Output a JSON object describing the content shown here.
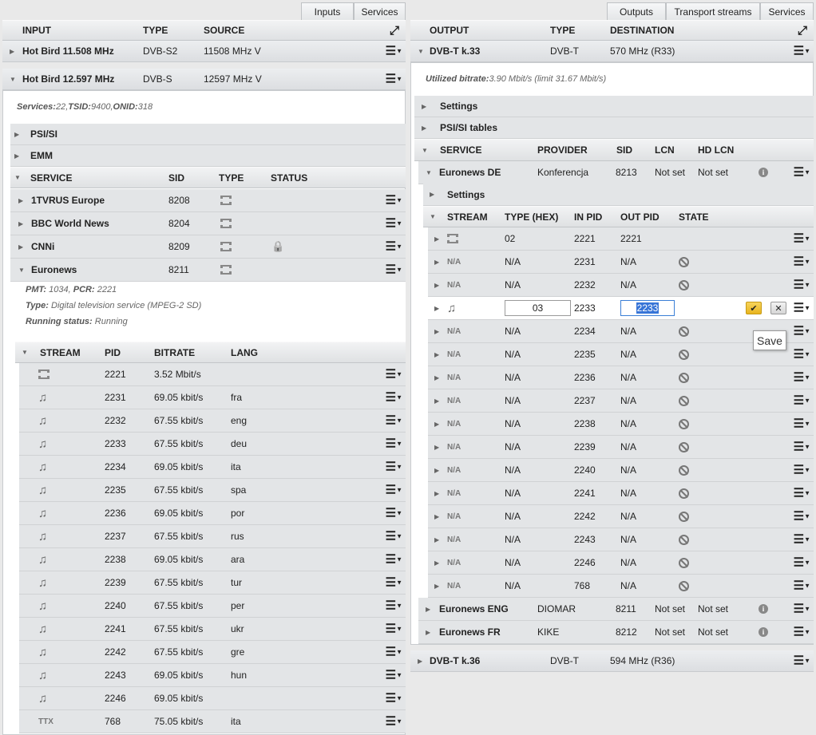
{
  "left": {
    "tabs": [
      "Inputs",
      "Services"
    ],
    "columns": {
      "input": "INPUT",
      "type": "TYPE",
      "source": "SOURCE"
    },
    "inputs": [
      {
        "name": "Hot Bird 11.508 MHz",
        "type": "DVB-S2",
        "source": "11508 MHz V"
      },
      {
        "name": "Hot Bird 12.597 MHz",
        "type": "DVB-S",
        "source": "12597 MHz V"
      }
    ],
    "summary": {
      "services_label": "Services:",
      "services": "22",
      "tsid_label": "TSID:",
      "tsid": "9400",
      "onid_label": "ONID:",
      "onid": "318"
    },
    "sections": [
      "PSI/SI",
      "EMM"
    ],
    "service_columns": {
      "service": "SERVICE",
      "sid": "SID",
      "type": "TYPE",
      "status": "STATUS"
    },
    "services": [
      {
        "name": "1TVRUS Europe",
        "sid": "8208"
      },
      {
        "name": "BBC World News",
        "sid": "8204"
      },
      {
        "name": "CNNi",
        "sid": "8209"
      },
      {
        "name": "Euronews",
        "sid": "8211"
      }
    ],
    "details": {
      "pmt_label": "PMT:",
      "pmt": "1034",
      "pcr_label": "PCR:",
      "pcr": "2221",
      "type_label": "Type:",
      "type": "Digital television service (MPEG-2 SD)",
      "status_label": "Running status:",
      "status": "Running"
    },
    "stream_columns": {
      "stream": "STREAM",
      "pid": "PID",
      "bitrate": "BITRATE",
      "lang": "LANG"
    },
    "streams": [
      {
        "icon": "film",
        "pid": "2221",
        "bitrate": "3.52 Mbit/s",
        "lang": ""
      },
      {
        "icon": "audio",
        "pid": "2231",
        "bitrate": "69.05 kbit/s",
        "lang": "fra"
      },
      {
        "icon": "audio",
        "pid": "2232",
        "bitrate": "67.55 kbit/s",
        "lang": "eng"
      },
      {
        "icon": "audio",
        "pid": "2233",
        "bitrate": "67.55 kbit/s",
        "lang": "deu"
      },
      {
        "icon": "audio",
        "pid": "2234",
        "bitrate": "69.05 kbit/s",
        "lang": "ita"
      },
      {
        "icon": "audio",
        "pid": "2235",
        "bitrate": "67.55 kbit/s",
        "lang": "spa"
      },
      {
        "icon": "audio",
        "pid": "2236",
        "bitrate": "69.05 kbit/s",
        "lang": "por"
      },
      {
        "icon": "audio",
        "pid": "2237",
        "bitrate": "67.55 kbit/s",
        "lang": "rus"
      },
      {
        "icon": "audio",
        "pid": "2238",
        "bitrate": "69.05 kbit/s",
        "lang": "ara"
      },
      {
        "icon": "audio",
        "pid": "2239",
        "bitrate": "67.55 kbit/s",
        "lang": "tur"
      },
      {
        "icon": "audio",
        "pid": "2240",
        "bitrate": "67.55 kbit/s",
        "lang": "per"
      },
      {
        "icon": "audio",
        "pid": "2241",
        "bitrate": "67.55 kbit/s",
        "lang": "ukr"
      },
      {
        "icon": "audio",
        "pid": "2242",
        "bitrate": "67.55 kbit/s",
        "lang": "gre"
      },
      {
        "icon": "audio",
        "pid": "2243",
        "bitrate": "69.05 kbit/s",
        "lang": "hun"
      },
      {
        "icon": "audio",
        "pid": "2246",
        "bitrate": "69.05 kbit/s",
        "lang": ""
      },
      {
        "icon": "ttx",
        "icon_text": "TTX",
        "pid": "768",
        "bitrate": "75.05 kbit/s",
        "lang": "ita"
      }
    ]
  },
  "right": {
    "tabs": [
      "Outputs",
      "Transport streams",
      "Services"
    ],
    "columns": {
      "output": "OUTPUT",
      "type": "TYPE",
      "destination": "DESTINATION"
    },
    "outputs": [
      {
        "name": "DVB-T k.33",
        "type": "DVB-T",
        "destination": "570 MHz (R33)"
      },
      {
        "name": "DVB-T k.36",
        "type": "DVB-T",
        "destination": "594 MHz (R36)"
      }
    ],
    "bitrate": {
      "label": "Utilized bitrate:",
      "value": "3.90 Mbit/s (limit 31.67 Mbit/s)"
    },
    "sections": [
      "Settings",
      "PSI/SI tables"
    ],
    "service_columns": {
      "service": "SERVICE",
      "provider": "PROVIDER",
      "sid": "SID",
      "lcn": "LCN",
      "hdlcn": "HD LCN"
    },
    "services": [
      {
        "name": "Euronews DE",
        "provider": "Konferencja",
        "sid": "8213",
        "lcn": "Not set",
        "hdlcn": "Not set"
      },
      {
        "name": "Euronews ENG",
        "provider": "DIOMAR",
        "sid": "8211",
        "lcn": "Not set",
        "hdlcn": "Not set"
      },
      {
        "name": "Euronews FR",
        "provider": "KIKE",
        "sid": "8212",
        "lcn": "Not set",
        "hdlcn": "Not set"
      }
    ],
    "settings_label": "Settings",
    "stream_columns": {
      "stream": "STREAM",
      "type": "TYPE (HEX)",
      "inpid": "IN PID",
      "outpid": "OUT PID",
      "state": "STATE"
    },
    "streams": [
      {
        "icon": "film",
        "type": "02",
        "inpid": "2221",
        "outpid": "2221",
        "state": ""
      },
      {
        "icon": "na",
        "icon_text": "N/A",
        "type": "N/A",
        "inpid": "2231",
        "outpid": "N/A",
        "state": "blocked"
      },
      {
        "icon": "na",
        "icon_text": "N/A",
        "type": "N/A",
        "inpid": "2232",
        "outpid": "N/A",
        "state": "blocked"
      },
      {
        "icon": "audio",
        "type": "03",
        "inpid": "2233",
        "outpid": "2233",
        "state": "edit"
      },
      {
        "icon": "na",
        "icon_text": "N/A",
        "type": "N/A",
        "inpid": "2234",
        "outpid": "N/A",
        "state": "blocked"
      },
      {
        "icon": "na",
        "icon_text": "N/A",
        "type": "N/A",
        "inpid": "2235",
        "outpid": "N/A",
        "state": "blocked"
      },
      {
        "icon": "na",
        "icon_text": "N/A",
        "type": "N/A",
        "inpid": "2236",
        "outpid": "N/A",
        "state": "blocked"
      },
      {
        "icon": "na",
        "icon_text": "N/A",
        "type": "N/A",
        "inpid": "2237",
        "outpid": "N/A",
        "state": "blocked"
      },
      {
        "icon": "na",
        "icon_text": "N/A",
        "type": "N/A",
        "inpid": "2238",
        "outpid": "N/A",
        "state": "blocked"
      },
      {
        "icon": "na",
        "icon_text": "N/A",
        "type": "N/A",
        "inpid": "2239",
        "outpid": "N/A",
        "state": "blocked"
      },
      {
        "icon": "na",
        "icon_text": "N/A",
        "type": "N/A",
        "inpid": "2240",
        "outpid": "N/A",
        "state": "blocked"
      },
      {
        "icon": "na",
        "icon_text": "N/A",
        "type": "N/A",
        "inpid": "2241",
        "outpid": "N/A",
        "state": "blocked"
      },
      {
        "icon": "na",
        "icon_text": "N/A",
        "type": "N/A",
        "inpid": "2242",
        "outpid": "N/A",
        "state": "blocked"
      },
      {
        "icon": "na",
        "icon_text": "N/A",
        "type": "N/A",
        "inpid": "2243",
        "outpid": "N/A",
        "state": "blocked"
      },
      {
        "icon": "na",
        "icon_text": "N/A",
        "type": "N/A",
        "inpid": "2246",
        "outpid": "N/A",
        "state": "blocked"
      },
      {
        "icon": "na",
        "icon_text": "N/A",
        "type": "N/A",
        "inpid": "768",
        "outpid": "N/A",
        "state": "blocked"
      }
    ],
    "tooltip": "Save"
  }
}
